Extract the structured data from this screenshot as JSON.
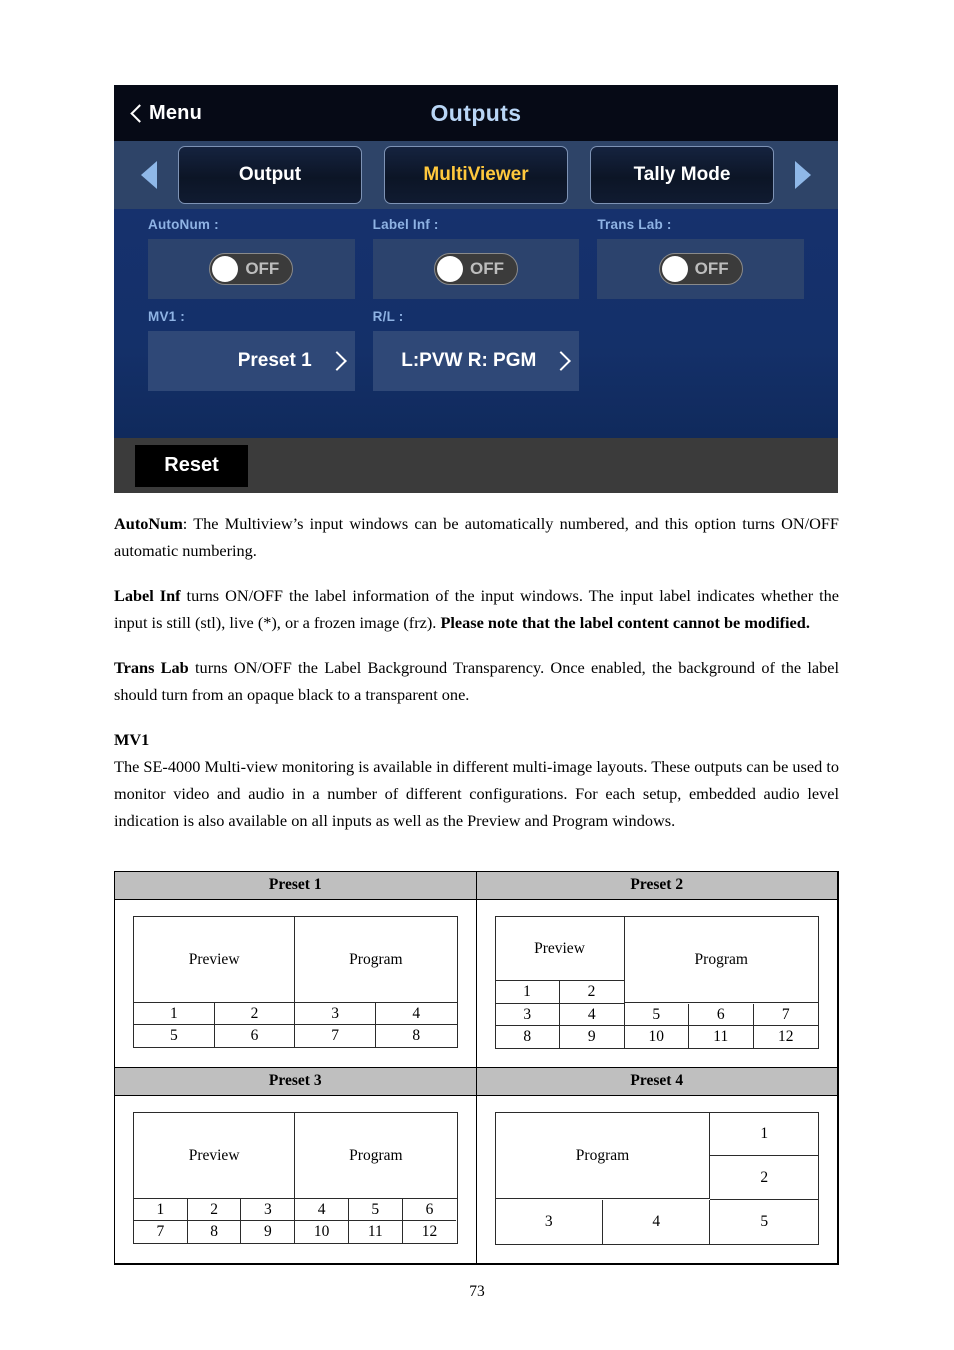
{
  "device": {
    "back_label": "Menu",
    "title": "Outputs",
    "tabs": [
      {
        "label": "Output",
        "active": false
      },
      {
        "label": "MultiViewer",
        "active": true
      },
      {
        "label": "Tally Mode",
        "active": false
      }
    ],
    "prev_arrow": "left-triangle",
    "next_arrow": "right-triangle",
    "fields": [
      {
        "label": "AutoNum :",
        "type": "toggle",
        "value": "OFF"
      },
      {
        "label": "Label Inf :",
        "type": "toggle",
        "value": "OFF"
      },
      {
        "label": "Trans Lab :",
        "type": "toggle",
        "value": "OFF"
      },
      {
        "label": "MV1 :",
        "type": "value",
        "value": "Preset 1"
      },
      {
        "label": "R/L :",
        "type": "value",
        "value": "L:PVW R: PGM"
      }
    ],
    "reset_label": "Reset",
    "colors": {
      "header_bg": "#060a16",
      "tab_bar_bg": "#2e4468",
      "body_bg": "#14306b",
      "panel_bg": "#2c436d",
      "accent_active": "#ffc83d",
      "title_blue": "#b9d6f6",
      "label_blue": "#8fb3e4",
      "footer_bg": "#3b3b3b",
      "reset_bg": "#000000"
    }
  },
  "doc": {
    "paragraphs": [
      {
        "id": "autonum",
        "bold_lead": "AutoNum",
        "text": ": The Multiview’s input windows can be automatically numbered, and this option turns ON/OFF automatic numbering."
      },
      {
        "id": "labelinf",
        "bold_lead": "Label Inf",
        "text": " turns ON/OFF the label information of the input windows. The input label indicates whether the input is still (stl), live (*), or a frozen image (frz). ",
        "bold_tail": "Please note that the label content cannot be modified."
      },
      {
        "id": "translab",
        "bold_lead": "Trans Lab",
        "text": " turns ON/OFF the Label Background Transparency. Once enabled, the background of the label should turn from an opaque black to a transparent one."
      }
    ],
    "mv1_heading": "MV1",
    "mv1_text": "The SE-4000 Multi-view monitoring is available in different multi-image layouts. These outputs can be used to monitor video and audio in a number of different configurations. For each setup, embedded audio level indication is also available on all inputs as well as the Preview and Program windows.",
    "page_number": "73"
  },
  "presets": [
    {
      "caption": "Preset 1",
      "big": [
        "Preview",
        "Program"
      ],
      "rows": [
        [
          "1",
          "2",
          "3",
          "4"
        ],
        [
          "5",
          "6",
          "7",
          "8"
        ]
      ]
    },
    {
      "caption": "Preset 2",
      "big": [
        "Preview",
        "Program"
      ],
      "left_top_row": [
        "1",
        "2"
      ],
      "rows": [
        [
          "3",
          "4",
          "5",
          "6",
          "7"
        ],
        [
          "8",
          "9",
          "10",
          "11",
          "12"
        ]
      ]
    },
    {
      "caption": "Preset 3",
      "big": [
        "Preview",
        "Program"
      ],
      "rows": [
        [
          "1",
          "2",
          "3",
          "4",
          "5",
          "6"
        ],
        [
          "7",
          "8",
          "9",
          "10",
          "11",
          "12"
        ]
      ]
    },
    {
      "caption": "Preset 4",
      "big": [
        "Program"
      ],
      "side": [
        "1",
        "2"
      ],
      "rows": [
        [
          "3",
          "4",
          "5"
        ]
      ]
    }
  ]
}
